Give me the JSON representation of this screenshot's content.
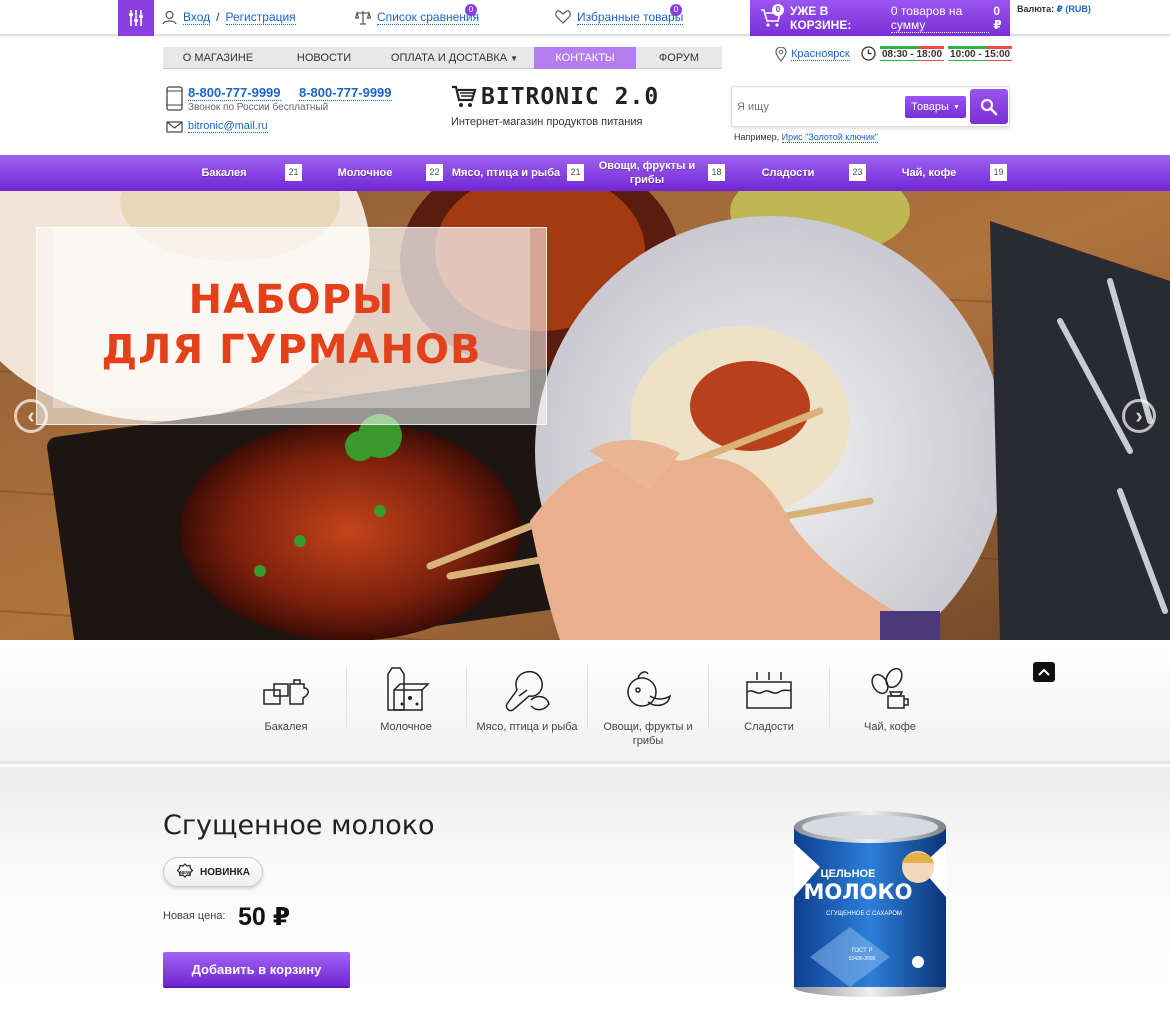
{
  "topbar": {
    "login_label": "Вход",
    "separator": "/",
    "register_label": "Регистрация",
    "compare_label": "Список сравнения",
    "compare_count": "0",
    "favorites_label": "Избранные товары",
    "favorites_count": "0",
    "cart_count": "0",
    "cart_prefix": "УЖЕ В КОРЗИНЕ:",
    "cart_link": "0 товаров на сумму",
    "cart_sum": "0 ₽",
    "currency_label": "Валюта:",
    "currency_value": "₽ (RUB)"
  },
  "nav": {
    "items": [
      {
        "label": "О магазине"
      },
      {
        "label": "Новости"
      },
      {
        "label": "Оплата и доставка"
      },
      {
        "label": "Контакты"
      },
      {
        "label": "Форум"
      }
    ],
    "city": "Красноярск",
    "hours_1": "08:30 - 18:00",
    "hours_2": "10:00 - 15:00"
  },
  "contacts": {
    "phone_1": "8-800-777-9999",
    "phone_2": "8-800-777-9999",
    "call_note": "Звонок по России бесплатный",
    "email": "bitronic@mail.ru"
  },
  "logo": {
    "name": "BITRONIC 2.0",
    "slogan": "Интернет-магазин продуктов питания"
  },
  "search": {
    "placeholder": "Я ищу",
    "category": "Товары",
    "example_prefix": "Например,",
    "example_link": "Ирис \"Золотой ключик\""
  },
  "categories": [
    {
      "name": "Бакалея",
      "count": "21"
    },
    {
      "name": "Молочное",
      "count": "22"
    },
    {
      "name": "Мясо, птица и рыба",
      "count": "21"
    },
    {
      "name": "Овощи, фрукты и грибы",
      "count": "18"
    },
    {
      "name": "Сладости",
      "count": "23"
    },
    {
      "name": "Чай, кофе",
      "count": "19"
    }
  ],
  "banner": {
    "line_1": "НАБОРЫ",
    "line_2": "ДЛЯ ГУРМАНОВ"
  },
  "icon_categories": [
    {
      "label": "Бакалея",
      "icon": "grocery-icon"
    },
    {
      "label": "Молочное",
      "icon": "dairy-icon"
    },
    {
      "label": "Мясо, птица и рыба",
      "icon": "meat-icon"
    },
    {
      "label": "Овощи, фрукты и грибы",
      "icon": "vegetables-icon"
    },
    {
      "label": "Сладости",
      "icon": "cake-icon"
    },
    {
      "label": "Чай, кофе",
      "icon": "coffee-icon"
    }
  ],
  "product": {
    "title": "Сгущенное молоко",
    "badge": "Новинка",
    "badge_icon_text": "NEW",
    "price_label": "Новая цена:",
    "price": "50 ₽",
    "add_to_cart": "Добавить в корзину",
    "can_line_1": "ЦЕЛЬНОЕ",
    "can_line_2": "МОЛОКО",
    "can_line_3": "СГУЩЕННОЕ С САХАРОМ",
    "can_line_4": "ГОСТ Р",
    "can_line_5": "53436-2009"
  },
  "colors": {
    "accent": "#8a3fe0",
    "link": "#1a64c9",
    "promo_text": "#e4401b"
  }
}
